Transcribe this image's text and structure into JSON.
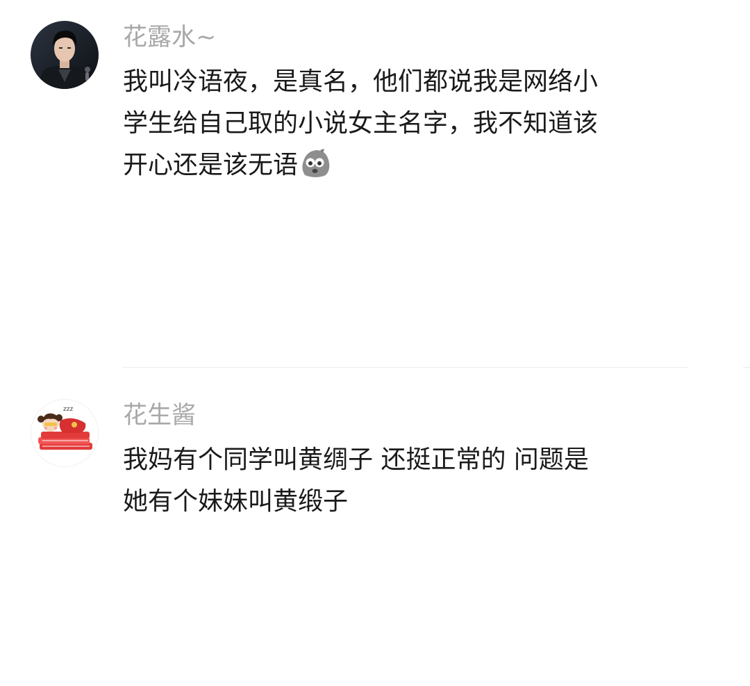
{
  "comments": [
    {
      "username": "花露水~",
      "lines": [
        "我叫冷语夜，是真名，他们都说我是网络小",
        "学生给自己取的小说女主名字，我不知道该",
        "开心还是该无语"
      ],
      "trailing_emoji": "speechless-stone-emoji"
    },
    {
      "username": "花生酱",
      "lines": [
        "我妈有个同学叫黄绸子 还挺正常的 问题是",
        "她有个妹妹叫黄缎子"
      ]
    }
  ],
  "colors": {
    "username": "#a8a8a8",
    "body_text": "#1a1a1a",
    "divider": "#ebebeb",
    "background": "#ffffff"
  }
}
